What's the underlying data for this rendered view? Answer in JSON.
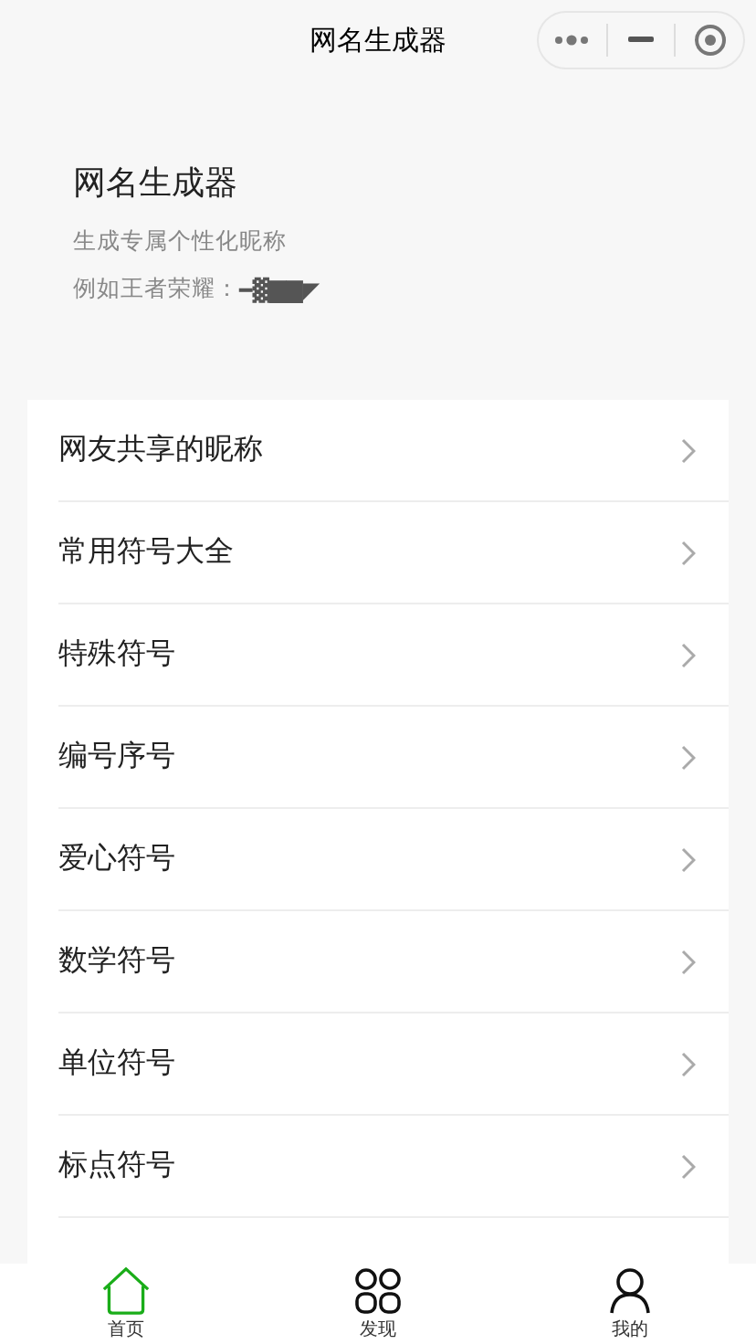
{
  "nav_bar": {
    "title": "网名生成器"
  },
  "header": {
    "title": "网名生成器",
    "subtitle": "生成专属个性化昵称",
    "example_label": "例如王者荣耀：",
    "example_value": "━▓▇▇◤"
  },
  "menu_items": [
    {
      "label": "网友共享的昵称"
    },
    {
      "label": "常用符号大全"
    },
    {
      "label": "特殊符号"
    },
    {
      "label": "编号序号"
    },
    {
      "label": "爱心符号"
    },
    {
      "label": "数学符号"
    },
    {
      "label": "单位符号"
    },
    {
      "label": "标点符号"
    }
  ],
  "tab_bar": [
    {
      "label": "首页",
      "kind": "home",
      "selected": true
    },
    {
      "label": "发现",
      "kind": "discover",
      "selected": false
    },
    {
      "label": "我的",
      "kind": "profile",
      "selected": false
    }
  ]
}
